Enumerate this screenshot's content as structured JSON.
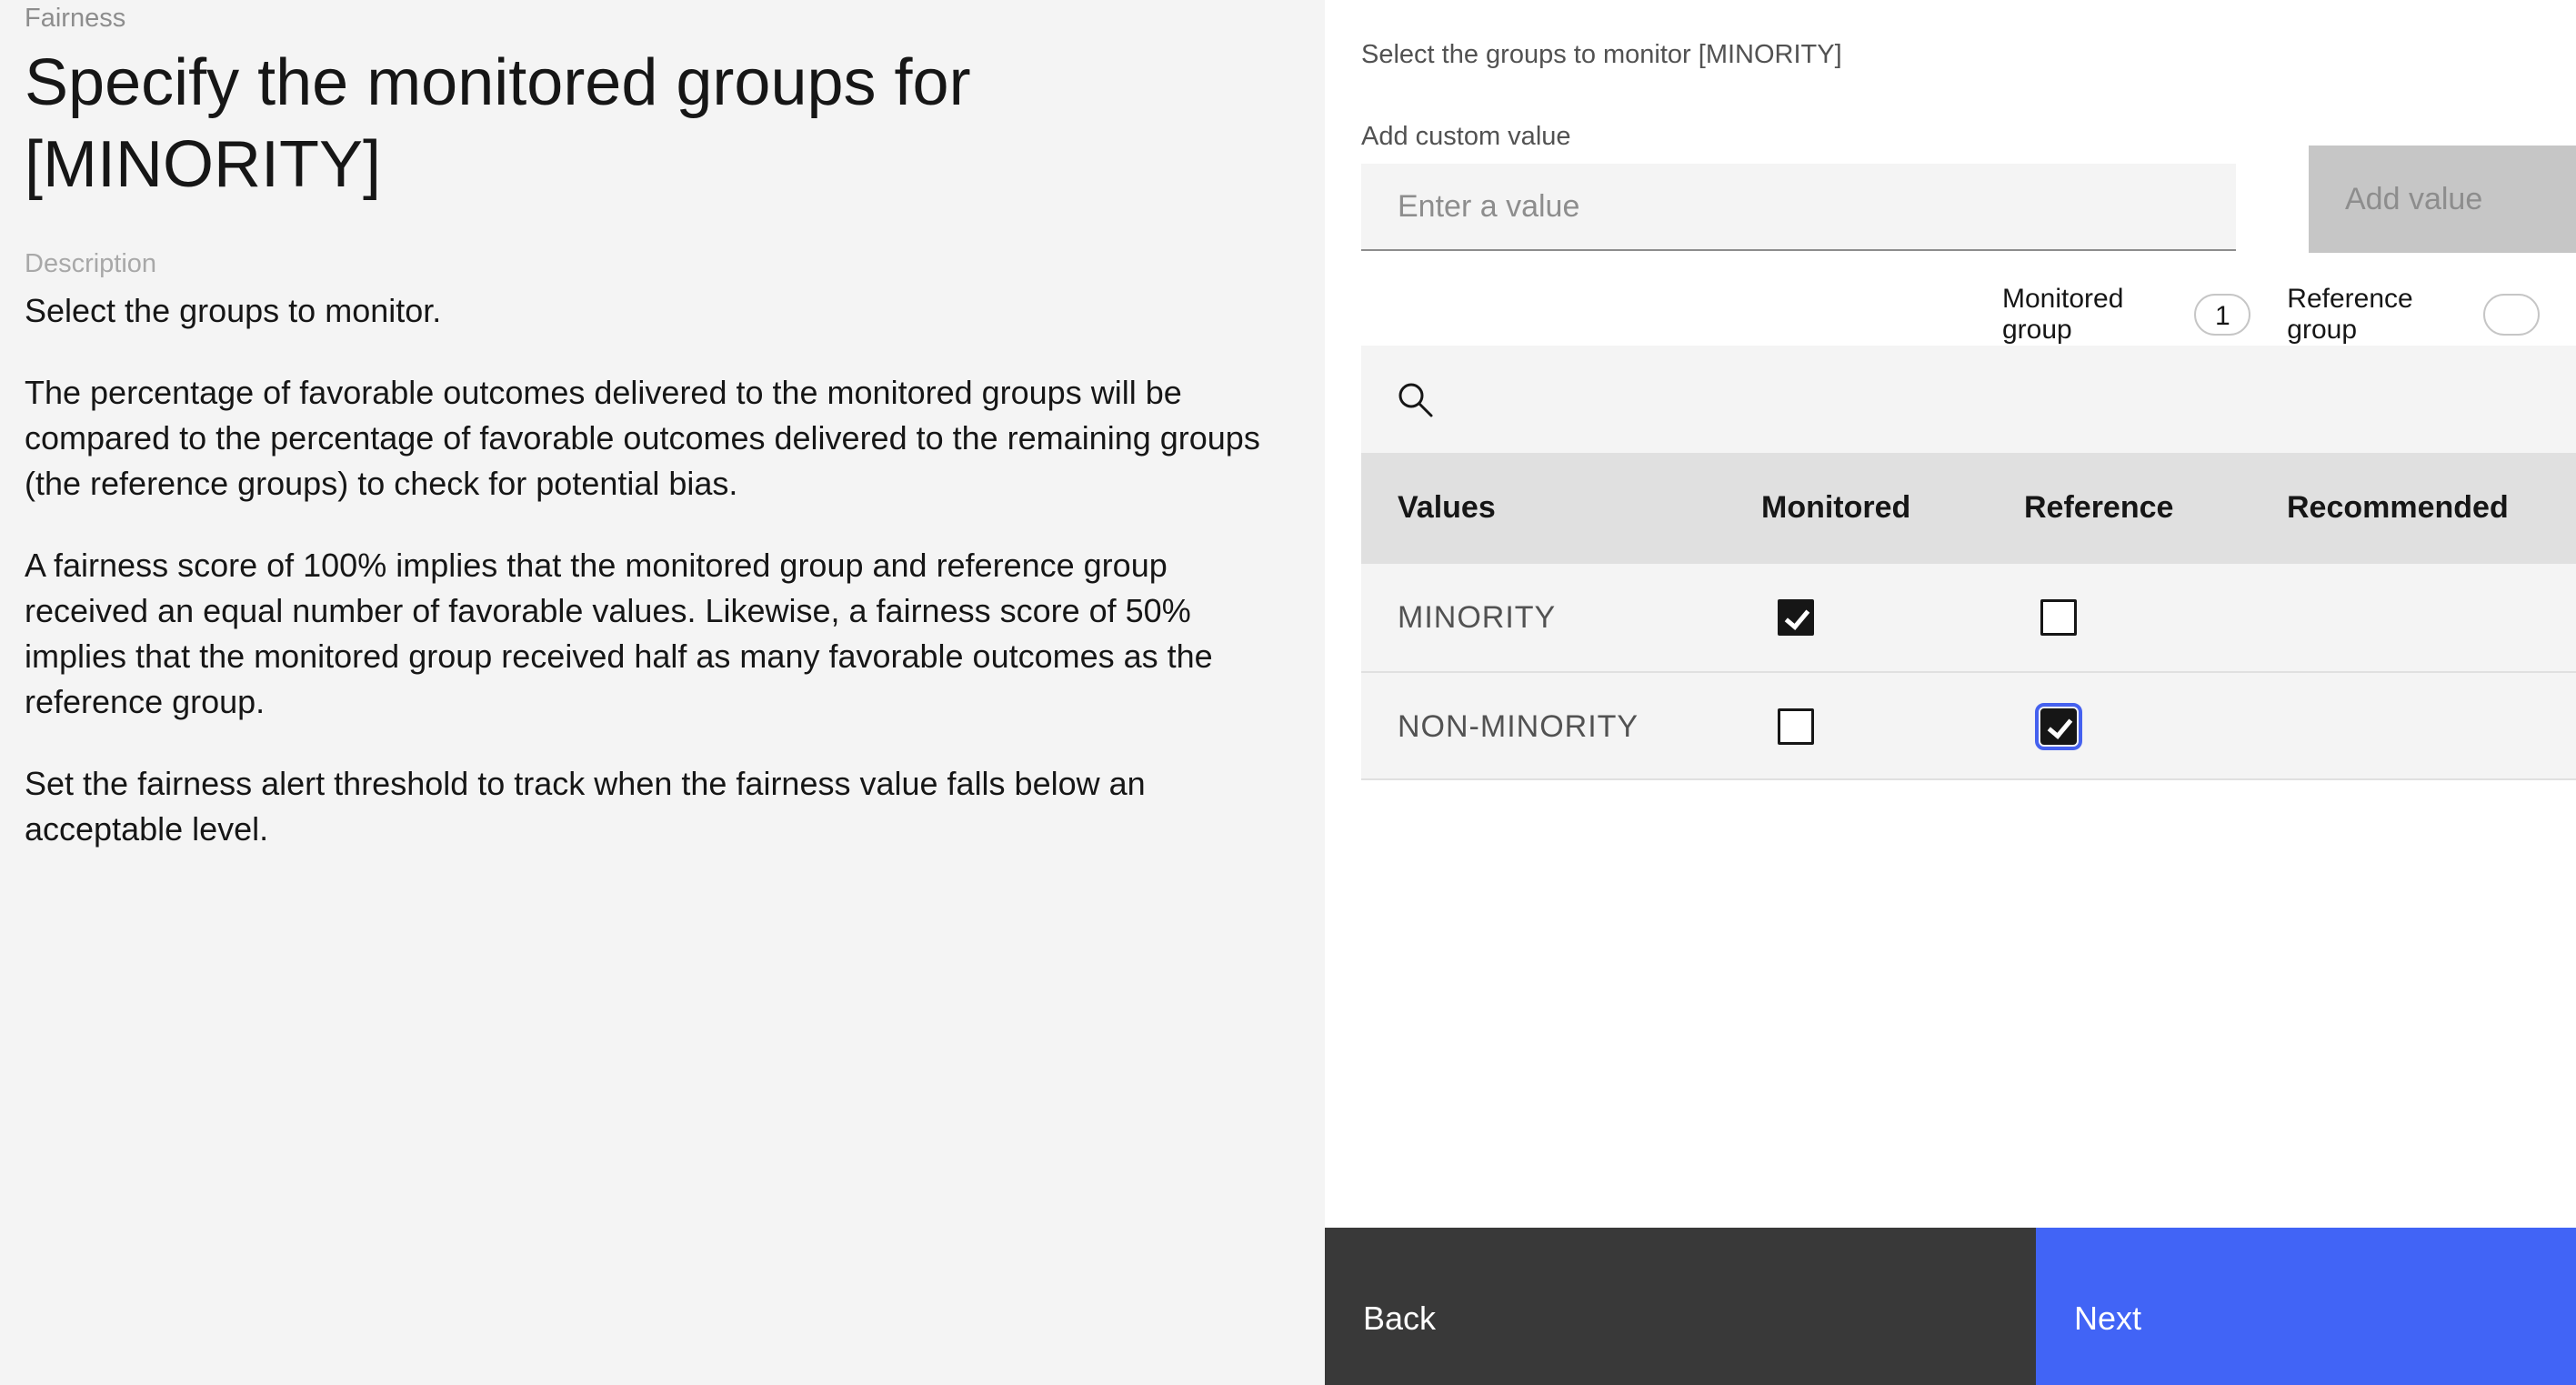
{
  "left_panel": {
    "eyebrow": "Fairness",
    "title": "Specify the monitored groups for [MINORITY]",
    "description_label": "Description",
    "paragraphs": [
      "Select the groups to monitor.",
      "The percentage of favorable outcomes delivered to the monitored groups will be compared to the percentage of favorable outcomes delivered to the remaining groups (the reference groups) to check for potential bias.",
      "A fairness score of 100% implies that the monitored group and reference group received an equal number of favorable values. Likewise, a fairness score of 50% implies that the monitored group received half as many favorable outcomes as the reference group.",
      "Set the fairness alert threshold to track when the fairness value falls below an acceptable level."
    ]
  },
  "right_panel": {
    "select_label": "Select the groups to monitor [MINORITY]",
    "custom_value_label": "Add custom value",
    "custom_value_placeholder": "Enter a value",
    "custom_value_value": "",
    "add_button_label": "Add value",
    "monitored_group_label": "Monitored group",
    "monitored_group_count": "1",
    "reference_group_label": "Reference group",
    "table": {
      "headers": [
        "Values",
        "Monitored",
        "Reference",
        "Recommended"
      ],
      "rows": [
        {
          "value": "MINORITY",
          "monitored": true,
          "reference": false,
          "recommended": ""
        },
        {
          "value": "NON-MINORITY",
          "monitored": false,
          "reference": true,
          "recommended": ""
        }
      ]
    }
  },
  "footer": {
    "back_label": "Back",
    "next_label": "Next"
  },
  "colors": {
    "left_bg": "#f4f4f4",
    "primary_button": "#4164f6",
    "secondary_button": "#393939",
    "focus_ring": "#4561ef"
  },
  "icons": {
    "search": "search-icon",
    "checkmark": "checkmark-icon"
  }
}
